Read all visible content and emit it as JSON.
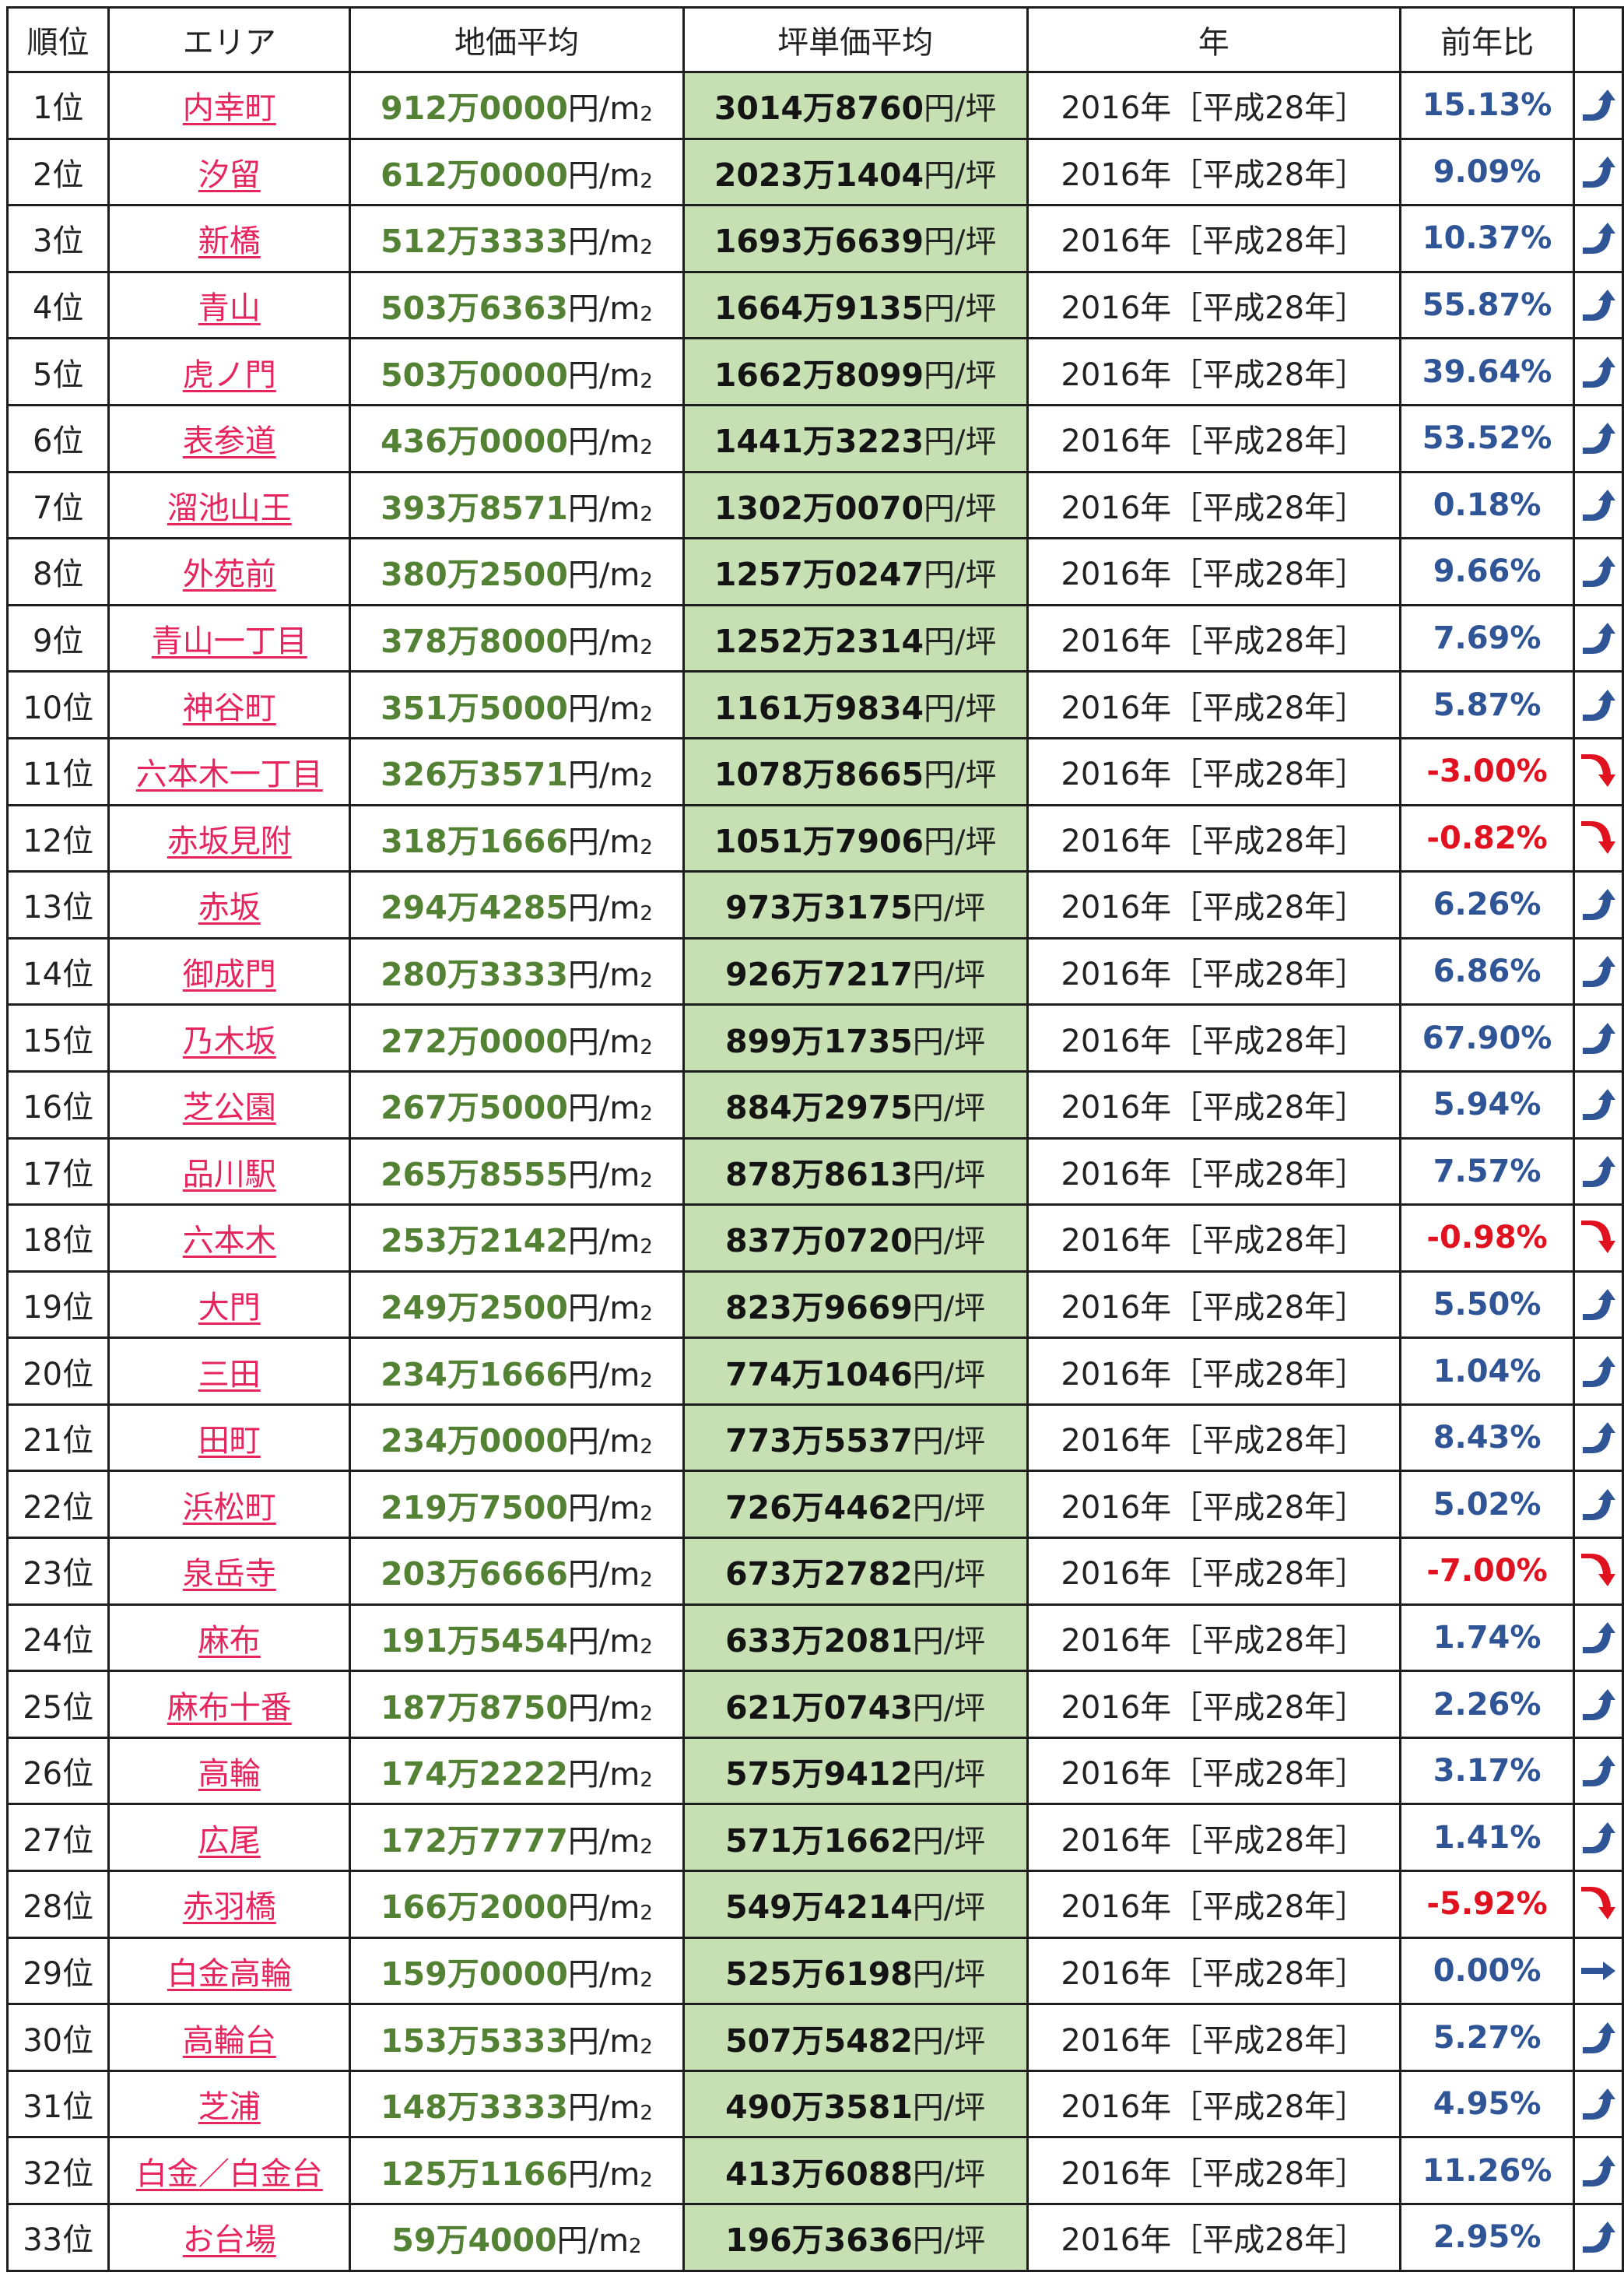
{
  "headers": [
    "順位",
    "エリア",
    "地価平均",
    "坪単価平均",
    "年",
    "前年比"
  ],
  "units": {
    "land": "円/m",
    "land_sub": "2",
    "tsubo": "円/坪"
  },
  "colors": {
    "area_link": "#e6245e",
    "land_value": "#548235",
    "tsubo_fill": "#c6e0b4",
    "yoy_up": "#2f5597",
    "yoy_down": "#e0121f"
  },
  "rows": [
    {
      "rank": "1位",
      "area": "内幸町",
      "land": "912万0000",
      "tsubo": "3014万8760",
      "year": "2016年［平成28年］",
      "yoy": "15.13%",
      "trend": "up"
    },
    {
      "rank": "2位",
      "area": "汐留",
      "land": "612万0000",
      "tsubo": "2023万1404",
      "year": "2016年［平成28年］",
      "yoy": "9.09%",
      "trend": "up"
    },
    {
      "rank": "3位",
      "area": "新橋",
      "land": "512万3333",
      "tsubo": "1693万6639",
      "year": "2016年［平成28年］",
      "yoy": "10.37%",
      "trend": "up"
    },
    {
      "rank": "4位",
      "area": "青山",
      "land": "503万6363",
      "tsubo": "1664万9135",
      "year": "2016年［平成28年］",
      "yoy": "55.87%",
      "trend": "up"
    },
    {
      "rank": "5位",
      "area": "虎ノ門",
      "land": "503万0000",
      "tsubo": "1662万8099",
      "year": "2016年［平成28年］",
      "yoy": "39.64%",
      "trend": "up"
    },
    {
      "rank": "6位",
      "area": "表参道",
      "land": "436万0000",
      "tsubo": "1441万3223",
      "year": "2016年［平成28年］",
      "yoy": "53.52%",
      "trend": "up"
    },
    {
      "rank": "7位",
      "area": "溜池山王",
      "land": "393万8571",
      "tsubo": "1302万0070",
      "year": "2016年［平成28年］",
      "yoy": "0.18%",
      "trend": "up"
    },
    {
      "rank": "8位",
      "area": "外苑前",
      "land": "380万2500",
      "tsubo": "1257万0247",
      "year": "2016年［平成28年］",
      "yoy": "9.66%",
      "trend": "up"
    },
    {
      "rank": "9位",
      "area": "青山一丁目",
      "land": "378万8000",
      "tsubo": "1252万2314",
      "year": "2016年［平成28年］",
      "yoy": "7.69%",
      "trend": "up"
    },
    {
      "rank": "10位",
      "area": "神谷町",
      "land": "351万5000",
      "tsubo": "1161万9834",
      "year": "2016年［平成28年］",
      "yoy": "5.87%",
      "trend": "up"
    },
    {
      "rank": "11位",
      "area": "六本木一丁目",
      "land": "326万3571",
      "tsubo": "1078万8665",
      "year": "2016年［平成28年］",
      "yoy": "-3.00%",
      "trend": "down"
    },
    {
      "rank": "12位",
      "area": "赤坂見附",
      "land": "318万1666",
      "tsubo": "1051万7906",
      "year": "2016年［平成28年］",
      "yoy": "-0.82%",
      "trend": "down"
    },
    {
      "rank": "13位",
      "area": "赤坂",
      "land": "294万4285",
      "tsubo": "973万3175",
      "year": "2016年［平成28年］",
      "yoy": "6.26%",
      "trend": "up"
    },
    {
      "rank": "14位",
      "area": "御成門",
      "land": "280万3333",
      "tsubo": "926万7217",
      "year": "2016年［平成28年］",
      "yoy": "6.86%",
      "trend": "up"
    },
    {
      "rank": "15位",
      "area": "乃木坂",
      "land": "272万0000",
      "tsubo": "899万1735",
      "year": "2016年［平成28年］",
      "yoy": "67.90%",
      "trend": "up"
    },
    {
      "rank": "16位",
      "area": "芝公園",
      "land": "267万5000",
      "tsubo": "884万2975",
      "year": "2016年［平成28年］",
      "yoy": "5.94%",
      "trend": "up"
    },
    {
      "rank": "17位",
      "area": "品川駅",
      "land": "265万8555",
      "tsubo": "878万8613",
      "year": "2016年［平成28年］",
      "yoy": "7.57%",
      "trend": "up"
    },
    {
      "rank": "18位",
      "area": "六本木",
      "land": "253万2142",
      "tsubo": "837万0720",
      "year": "2016年［平成28年］",
      "yoy": "-0.98%",
      "trend": "down"
    },
    {
      "rank": "19位",
      "area": "大門",
      "land": "249万2500",
      "tsubo": "823万9669",
      "year": "2016年［平成28年］",
      "yoy": "5.50%",
      "trend": "up"
    },
    {
      "rank": "20位",
      "area": "三田",
      "land": "234万1666",
      "tsubo": "774万1046",
      "year": "2016年［平成28年］",
      "yoy": "1.04%",
      "trend": "up"
    },
    {
      "rank": "21位",
      "area": "田町",
      "land": "234万0000",
      "tsubo": "773万5537",
      "year": "2016年［平成28年］",
      "yoy": "8.43%",
      "trend": "up"
    },
    {
      "rank": "22位",
      "area": "浜松町",
      "land": "219万7500",
      "tsubo": "726万4462",
      "year": "2016年［平成28年］",
      "yoy": "5.02%",
      "trend": "up"
    },
    {
      "rank": "23位",
      "area": "泉岳寺",
      "land": "203万6666",
      "tsubo": "673万2782",
      "year": "2016年［平成28年］",
      "yoy": "-7.00%",
      "trend": "down"
    },
    {
      "rank": "24位",
      "area": "麻布",
      "land": "191万5454",
      "tsubo": "633万2081",
      "year": "2016年［平成28年］",
      "yoy": "1.74%",
      "trend": "up"
    },
    {
      "rank": "25位",
      "area": "麻布十番",
      "land": "187万8750",
      "tsubo": "621万0743",
      "year": "2016年［平成28年］",
      "yoy": "2.26%",
      "trend": "up"
    },
    {
      "rank": "26位",
      "area": "高輪",
      "land": "174万2222",
      "tsubo": "575万9412",
      "year": "2016年［平成28年］",
      "yoy": "3.17%",
      "trend": "up"
    },
    {
      "rank": "27位",
      "area": "広尾",
      "land": "172万7777",
      "tsubo": "571万1662",
      "year": "2016年［平成28年］",
      "yoy": "1.41%",
      "trend": "up"
    },
    {
      "rank": "28位",
      "area": "赤羽橋",
      "land": "166万2000",
      "tsubo": "549万4214",
      "year": "2016年［平成28年］",
      "yoy": "-5.92%",
      "trend": "down"
    },
    {
      "rank": "29位",
      "area": "白金高輪",
      "land": "159万0000",
      "tsubo": "525万6198",
      "year": "2016年［平成28年］",
      "yoy": "0.00%",
      "trend": "flat"
    },
    {
      "rank": "30位",
      "area": "高輪台",
      "land": "153万5333",
      "tsubo": "507万5482",
      "year": "2016年［平成28年］",
      "yoy": "5.27%",
      "trend": "up"
    },
    {
      "rank": "31位",
      "area": "芝浦",
      "land": "148万3333",
      "tsubo": "490万3581",
      "year": "2016年［平成28年］",
      "yoy": "4.95%",
      "trend": "up"
    },
    {
      "rank": "32位",
      "area": "白金／白金台",
      "land": "125万1166",
      "tsubo": "413万6088",
      "year": "2016年［平成28年］",
      "yoy": "11.26%",
      "trend": "up"
    },
    {
      "rank": "33位",
      "area": "お台場",
      "land": "59万4000",
      "tsubo": "196万3636",
      "year": "2016年［平成28年］",
      "yoy": "2.95%",
      "trend": "up"
    }
  ]
}
